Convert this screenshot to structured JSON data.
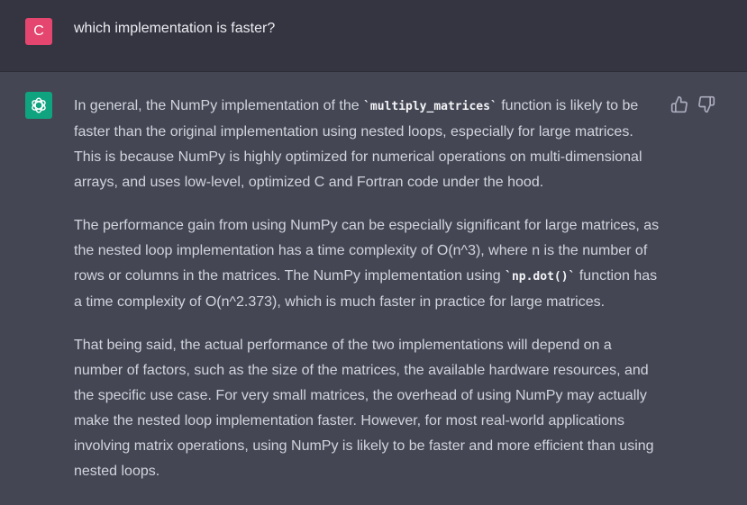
{
  "user": {
    "avatar_letter": "C",
    "message": "which implementation is faster?"
  },
  "assistant": {
    "icon": "openai-logo-icon",
    "p1": {
      "a": "In general, the NumPy implementation of the ",
      "code": "`multiply_matrices`",
      "b": " function is likely to be faster than the original implementation using nested loops, especially for large matrices. This is because NumPy is highly optimized for numerical operations on multi-dimensional arrays, and uses low-level, optimized C and Fortran code under the hood."
    },
    "p2": {
      "a": "The performance gain from using NumPy can be especially significant for large matrices, as the nested loop implementation has a time complexity of O(n^3), where n is the number of rows or columns in the matrices. The NumPy implementation using ",
      "code": "`np.dot()`",
      "b": " function has a time complexity of O(n^2.373), which is much faster in practice for large matrices."
    },
    "p3": "That being said, the actual performance of the two implementations will depend on a number of factors, such as the size of the matrices, the available hardware resources, and the specific use case. For very small matrices, the overhead of using NumPy may actually make the nested loop implementation faster. However, for most real-world applications involving matrix operations, using NumPy is likely to be faster and more efficient than using nested loops."
  },
  "feedback": {
    "thumbs_up": "thumbs-up-icon",
    "thumbs_down": "thumbs-down-icon"
  }
}
